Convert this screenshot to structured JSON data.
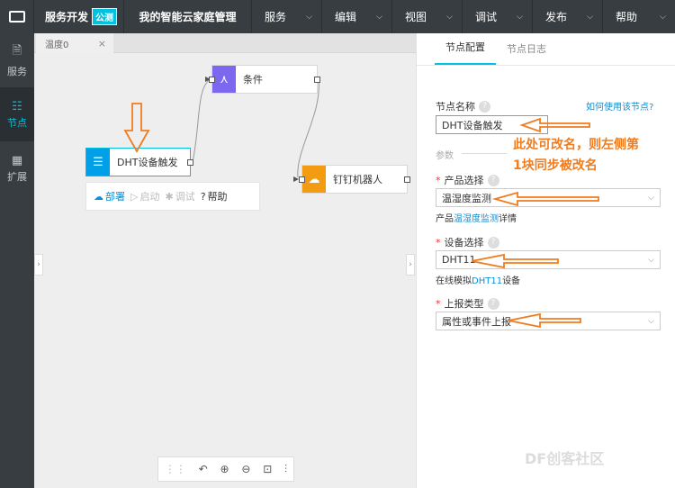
{
  "topbar": {
    "brand": "服务开发",
    "badge": "公测",
    "project": "我的智能云家庭管理",
    "menus": [
      "服务",
      "编辑",
      "视图",
      "调试",
      "发布",
      "帮助"
    ]
  },
  "leftnav": {
    "items": [
      {
        "label": "服务",
        "icon": "document-icon"
      },
      {
        "label": "节点",
        "icon": "node-icon"
      },
      {
        "label": "扩展",
        "icon": "grid-icon"
      }
    ]
  },
  "canvas": {
    "tab": "温度0",
    "nodes": {
      "condition": "条件",
      "dht": "DHT设备触发",
      "robot": "钉钉机器人"
    },
    "actions": {
      "deploy": "部署",
      "start": "启动",
      "debug": "调试",
      "help": "帮助"
    }
  },
  "panel": {
    "tabs": [
      "节点配置",
      "节点日志"
    ],
    "howto": "如何使用该节点?",
    "node_name_label": "节点名称",
    "node_name_value": "DHT设备触发",
    "params_label": "参数",
    "product_label": "产品选择",
    "product_value": "温湿度监测",
    "product_hint_pre": "产品",
    "product_hint_link": "温湿度监测",
    "product_hint_post": "详情",
    "device_label": "设备选择",
    "device_value": "DHT11",
    "device_hint_pre": "在线模拟",
    "device_hint_link": "DHT11",
    "device_hint_post": "设备",
    "report_label": "上报类型",
    "report_value": "属性或事件上报"
  },
  "annotation": {
    "line1": "此处可改名，则左侧第",
    "line2": "1块同步被改名"
  },
  "watermark": "DF创客社区",
  "colors": {
    "accent": "#00c1de",
    "annot": "#f07c1e"
  }
}
